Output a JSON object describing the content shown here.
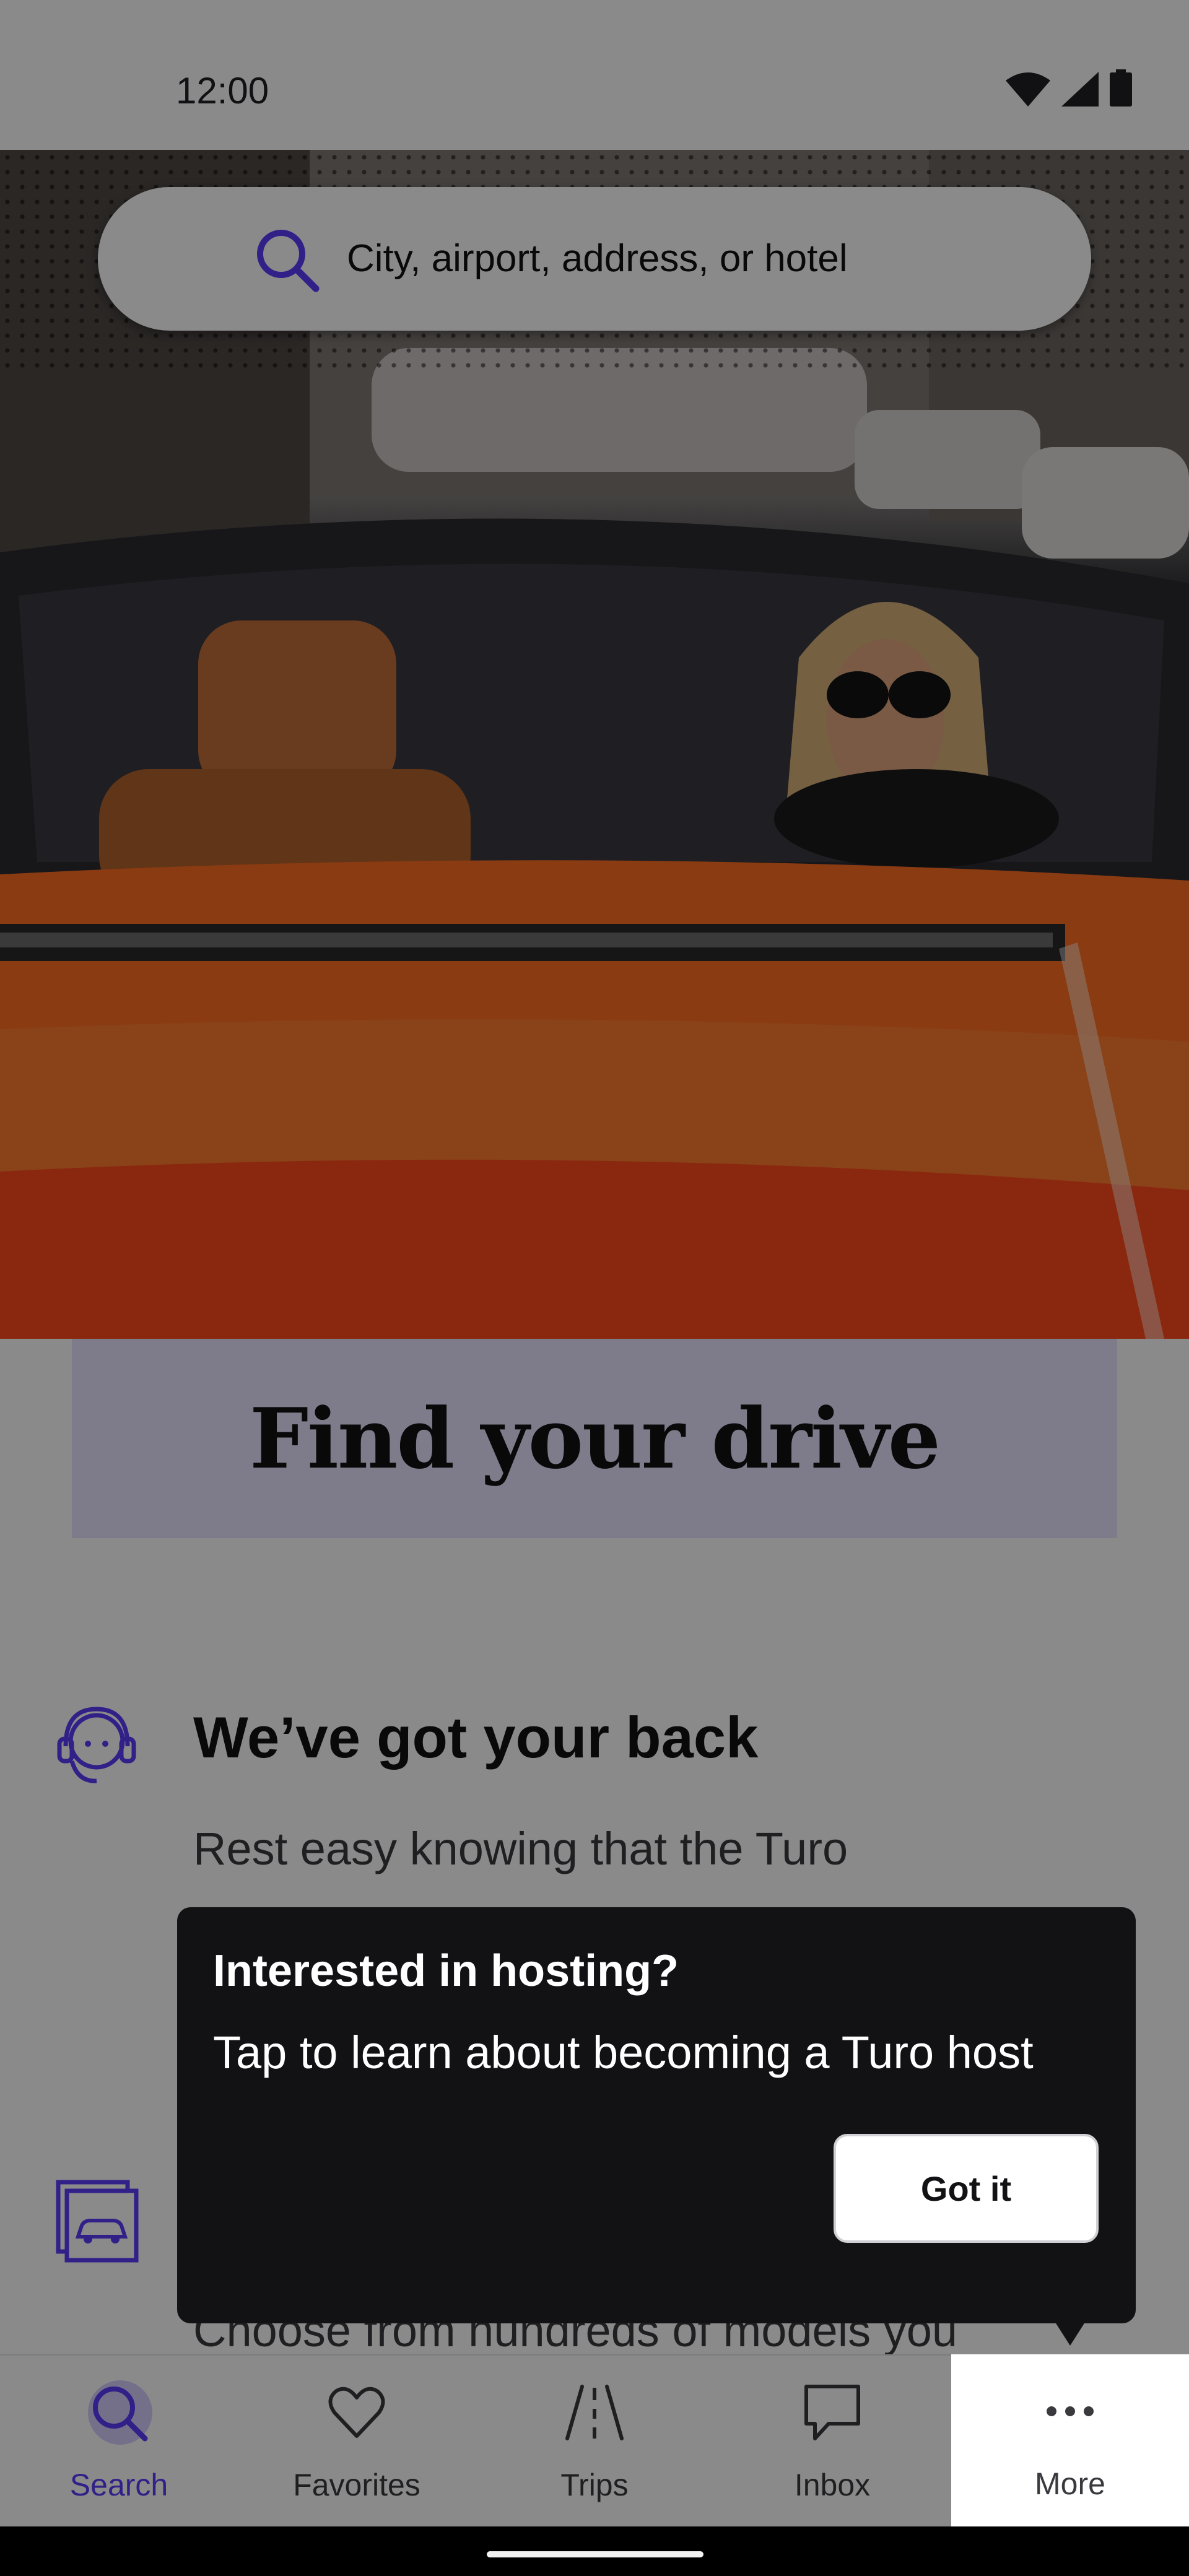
{
  "status_bar": {
    "time": "12:00",
    "icons": [
      "wifi-icon",
      "signal-icon",
      "battery-icon"
    ]
  },
  "search": {
    "placeholder": "City, airport, address, or hotel",
    "icon": "search-icon"
  },
  "hero": {
    "title": "Find your drive"
  },
  "features": [
    {
      "icon": "support-agent-icon",
      "heading": "We’ve got your back",
      "body": "Rest easy knowing that the Turo"
    },
    {
      "icon": "car-gallery-icon",
      "body": "Choose from hundreds of models you"
    }
  ],
  "tooltip": {
    "title": "Interested in hosting?",
    "body": "Tap to learn about becoming a Turo host",
    "button": "Got it"
  },
  "bottom_nav": {
    "items": [
      {
        "label": "Search",
        "icon": "search-icon",
        "active": true
      },
      {
        "label": "Favorites",
        "icon": "heart-icon",
        "active": false
      },
      {
        "label": "Trips",
        "icon": "road-icon",
        "active": false
      },
      {
        "label": "Inbox",
        "icon": "chat-bubble-icon",
        "active": false
      },
      {
        "label": "More",
        "icon": "more-horizontal-icon",
        "active": false
      }
    ]
  },
  "colors": {
    "brand_purple": "#593cfb",
    "title_band": "#e9e5ff",
    "tooltip_bg": "#121214",
    "car_orange": "#ff6a1e"
  }
}
